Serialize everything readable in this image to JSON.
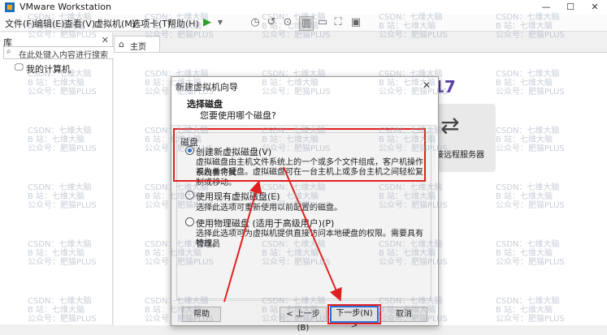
{
  "window": {
    "title": "VMware Workstation",
    "controls": {
      "minimize": "—",
      "maximize": "☐",
      "close": "✕"
    }
  },
  "menu": [
    "文件(F)",
    "编辑(E)",
    "查看(V)",
    "虚拟机(M)",
    "选项卡(T)",
    "帮助(H)"
  ],
  "library": {
    "header": "库",
    "close": "✕",
    "search_placeholder": "在此处键入内容进行搜索",
    "tree_root": "我的计算机"
  },
  "tabs": {
    "home": "主页"
  },
  "home": {
    "brand_suffix": "17",
    "remote_card_label": "接远程服务器"
  },
  "dialog": {
    "title": "新建虚拟机向导",
    "heading": "选择磁盘",
    "subheading": "您要使用哪个磁盘?",
    "group_label": "磁盘",
    "options": [
      {
        "label": "创建新虚拟磁盘(V)",
        "checked": true,
        "desc_line1": "虚拟磁盘由主机文件系统上的一个或多个文件组成，客户机操作系统会将其",
        "desc_line2": "视为单个硬盘。虚拟磁盘可在一台主机上或多台主机之间轻松复制或移动。"
      },
      {
        "label": "使用现有虚拟磁盘(E)",
        "checked": false,
        "desc_line1": "选择此选项可重新使用以前配置的磁盘。"
      },
      {
        "label": "使用物理磁盘 (适用于高级用户)(P)",
        "checked": false,
        "desc_line1": "选择此选项可为虚拟机提供直接访问本地硬盘的权限。需要具有管理员",
        "desc_line2": "特权。"
      }
    ],
    "buttons": {
      "help": "帮助",
      "back": "< 上一步(B)",
      "next": "下一步(N) >",
      "cancel": "取消"
    }
  },
  "watermark": {
    "line1": "CSDN：七维大脑",
    "line2": "B 站：七维大脑",
    "line3": "公众号：肥猫PLUS"
  },
  "colors": {
    "annotation": "#e02020",
    "brand": "#5a3da8",
    "selected_radio": "#1f5bd3"
  }
}
